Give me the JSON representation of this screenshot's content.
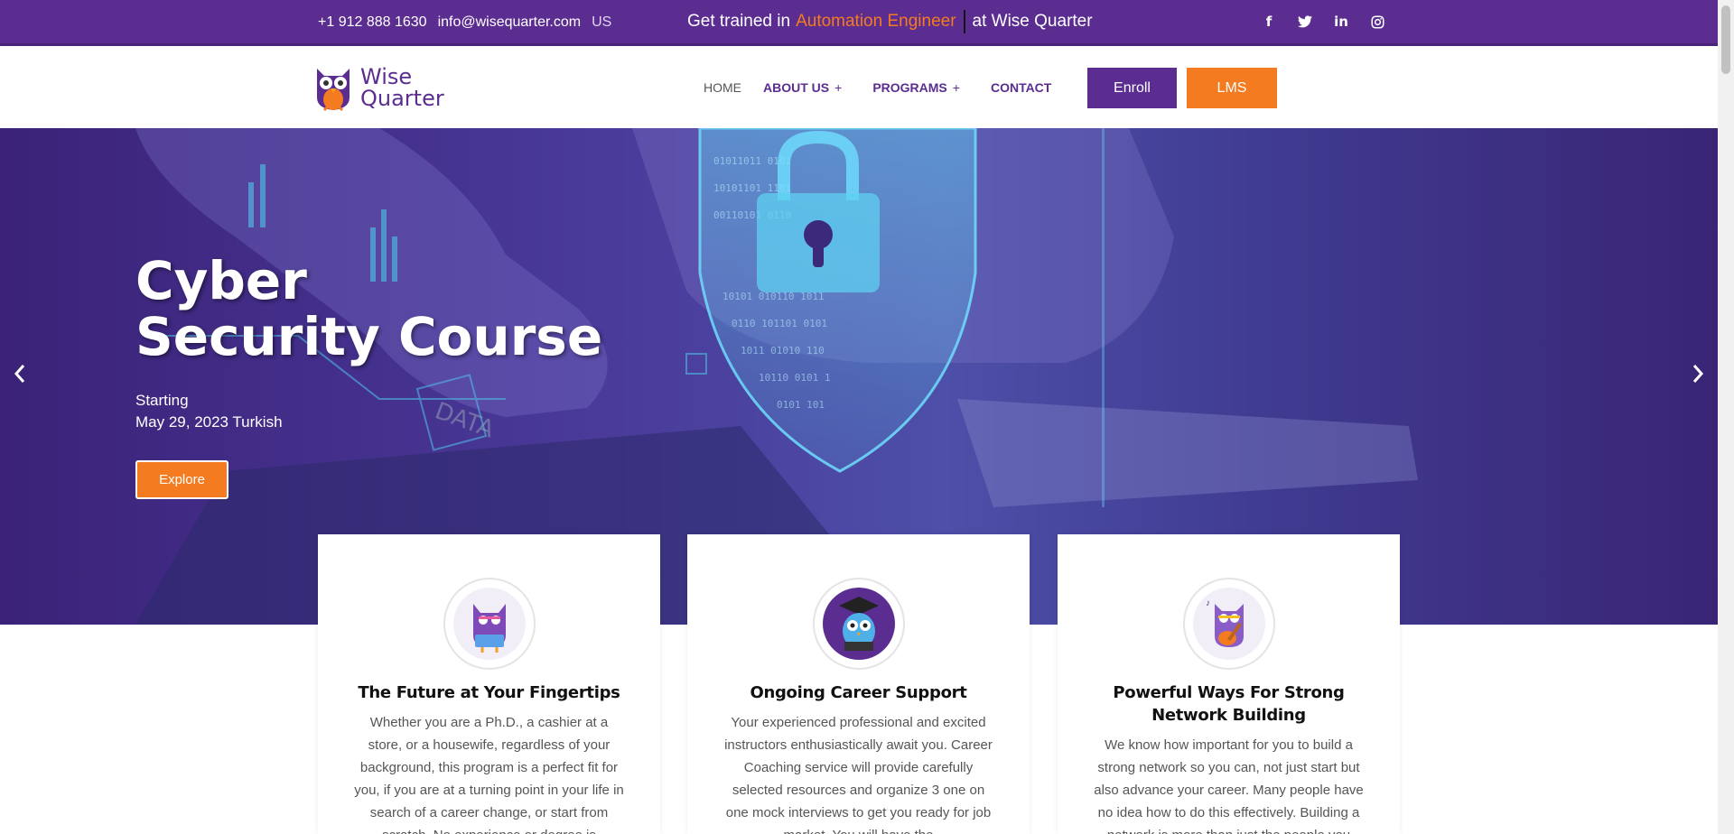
{
  "topbar": {
    "phone": "+1 912 888 1630",
    "email": "info@wisequarter.com",
    "region": "US",
    "promo_prefix": "Get trained in",
    "promo_highlight": "Automation Engineer",
    "promo_suffix": "at Wise Quarter",
    "socials": [
      {
        "icon": "facebook-icon",
        "glyph": "f"
      },
      {
        "icon": "twitter-icon",
        "glyph": "t"
      },
      {
        "icon": "linkedin-icon",
        "glyph": "in"
      },
      {
        "icon": "instagram-icon",
        "glyph": "◎"
      }
    ]
  },
  "navbar": {
    "logo_line1": "Wise",
    "logo_line2": "Quarter",
    "items": [
      {
        "label": "HOME",
        "has_submenu": false
      },
      {
        "label": "ABOUT US",
        "has_submenu": true
      },
      {
        "label": "PROGRAMS",
        "has_submenu": true
      },
      {
        "label": "CONTACT",
        "has_submenu": false
      }
    ],
    "submenu_marker": "+",
    "enroll_label": "Enroll",
    "lms_label": "LMS"
  },
  "hero": {
    "title_line1": "Cyber",
    "title_line2": "Security Course",
    "starting_label": "Starting",
    "date_text": "May 29, 2023 Turkish",
    "explore_label": "Explore",
    "prev_icon": "chevron-left-icon",
    "next_icon": "chevron-right-icon"
  },
  "cards": [
    {
      "title": "The Future at Your Fingertips",
      "text": "Whether you are a Ph.D., a cashier at a store, or a housewife, regardless of your background, this program is a perfect fit for you, if you are at a turning point in your life in search of a career change, or start from scratch. No experience or degree is",
      "icon": "owl-laptop-icon"
    },
    {
      "title": "Ongoing Career Support",
      "text": "Your experienced professional and excited instructors enthusiastically await you. Career Coaching service will provide carefully selected resources and organize 3 one on one mock interviews to get you ready for job market. You will have the",
      "icon": "owl-graduate-icon"
    },
    {
      "title": "Powerful Ways For Strong Network Building",
      "text": "We know how important for you to build a strong network so you can, not just start but also advance your career. Many people have no idea how to do this effectively. Building a network is more than just the people you",
      "icon": "owl-guitar-icon"
    }
  ],
  "colors": {
    "brand_purple": "#5b2d91",
    "brand_orange": "#f47b20"
  }
}
